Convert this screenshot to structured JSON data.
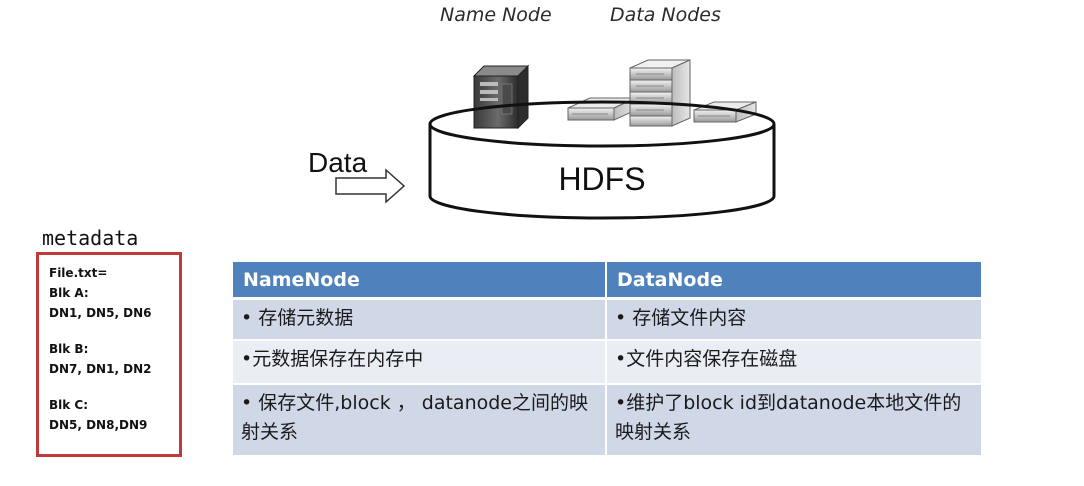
{
  "diagram": {
    "name_node_label": "Name Node",
    "data_nodes_label": "Data Nodes",
    "hdfs_label": "HDFS",
    "data_label": "Data"
  },
  "metadata": {
    "title": "metadata",
    "lines": [
      "File.txt=",
      "Blk A:",
      "DN1, DN5, DN6",
      "",
      "Blk B:",
      "DN7, DN1, DN2",
      "",
      "Blk C:",
      "DN5, DN8,DN9"
    ]
  },
  "table": {
    "headers": [
      "NameNode",
      "DataNode"
    ],
    "rows": [
      [
        "• 存储元数据",
        "• 存储文件内容"
      ],
      [
        "•元数据保存在内存中",
        "•文件内容保存在磁盘"
      ],
      [
        "• 保存文件,block ， datanode之间的映射关系",
        "•维护了block id到datanode本地文件的映射关系"
      ]
    ]
  }
}
